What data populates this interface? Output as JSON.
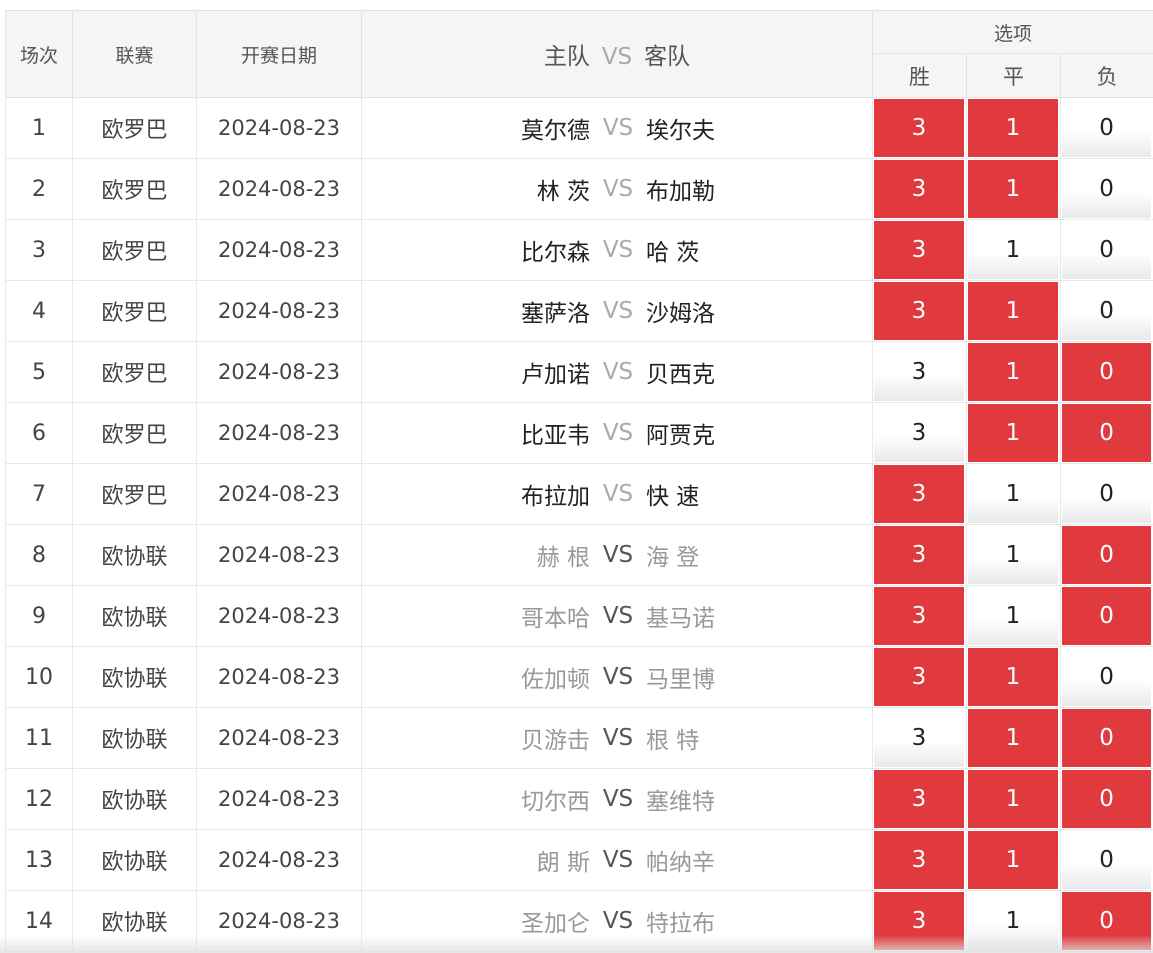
{
  "header": {
    "idx": "场次",
    "league": "联赛",
    "date": "开赛日期",
    "home": "主队",
    "vs": "VS",
    "away": "客队",
    "options": "选项",
    "win": "胜",
    "draw": "平",
    "lose": "负"
  },
  "colors": {
    "selected": "#e03a3e",
    "header_bg": "#f5f5f5"
  },
  "rows": [
    {
      "idx": "1",
      "league": "欧罗巴",
      "date": "2024-08-23",
      "home": "莫尔德",
      "vs": "VS",
      "away": "埃尔夫",
      "dim": false,
      "win": "3",
      "draw": "1",
      "lose": "0",
      "win_sel": true,
      "draw_sel": true,
      "lose_sel": false
    },
    {
      "idx": "2",
      "league": "欧罗巴",
      "date": "2024-08-23",
      "home": "林 茨",
      "vs": "VS",
      "away": "布加勒",
      "dim": false,
      "win": "3",
      "draw": "1",
      "lose": "0",
      "win_sel": true,
      "draw_sel": true,
      "lose_sel": false
    },
    {
      "idx": "3",
      "league": "欧罗巴",
      "date": "2024-08-23",
      "home": "比尔森",
      "vs": "VS",
      "away": "哈 茨",
      "dim": false,
      "win": "3",
      "draw": "1",
      "lose": "0",
      "win_sel": true,
      "draw_sel": false,
      "lose_sel": false
    },
    {
      "idx": "4",
      "league": "欧罗巴",
      "date": "2024-08-23",
      "home": "塞萨洛",
      "vs": "VS",
      "away": "沙姆洛",
      "dim": false,
      "win": "3",
      "draw": "1",
      "lose": "0",
      "win_sel": true,
      "draw_sel": true,
      "lose_sel": false
    },
    {
      "idx": "5",
      "league": "欧罗巴",
      "date": "2024-08-23",
      "home": "卢加诺",
      "vs": "VS",
      "away": "贝西克",
      "dim": false,
      "win": "3",
      "draw": "1",
      "lose": "0",
      "win_sel": false,
      "draw_sel": true,
      "lose_sel": true
    },
    {
      "idx": "6",
      "league": "欧罗巴",
      "date": "2024-08-23",
      "home": "比亚韦",
      "vs": "VS",
      "away": "阿贾克",
      "dim": false,
      "win": "3",
      "draw": "1",
      "lose": "0",
      "win_sel": false,
      "draw_sel": true,
      "lose_sel": true
    },
    {
      "idx": "7",
      "league": "欧罗巴",
      "date": "2024-08-23",
      "home": "布拉加",
      "vs": "VS",
      "away": "快 速",
      "dim": false,
      "win": "3",
      "draw": "1",
      "lose": "0",
      "win_sel": true,
      "draw_sel": false,
      "lose_sel": false
    },
    {
      "idx": "8",
      "league": "欧协联",
      "date": "2024-08-23",
      "home": "赫 根",
      "vs": "VS",
      "away": "海 登",
      "dim": true,
      "win": "3",
      "draw": "1",
      "lose": "0",
      "win_sel": true,
      "draw_sel": false,
      "lose_sel": true
    },
    {
      "idx": "9",
      "league": "欧协联",
      "date": "2024-08-23",
      "home": "哥本哈",
      "vs": "VS",
      "away": "基马诺",
      "dim": true,
      "win": "3",
      "draw": "1",
      "lose": "0",
      "win_sel": true,
      "draw_sel": false,
      "lose_sel": true
    },
    {
      "idx": "10",
      "league": "欧协联",
      "date": "2024-08-23",
      "home": "佐加顿",
      "vs": "VS",
      "away": "马里博",
      "dim": true,
      "win": "3",
      "draw": "1",
      "lose": "0",
      "win_sel": true,
      "draw_sel": true,
      "lose_sel": false
    },
    {
      "idx": "11",
      "league": "欧协联",
      "date": "2024-08-23",
      "home": "贝游击",
      "vs": "VS",
      "away": "根 特",
      "dim": true,
      "win": "3",
      "draw": "1",
      "lose": "0",
      "win_sel": false,
      "draw_sel": true,
      "lose_sel": true
    },
    {
      "idx": "12",
      "league": "欧协联",
      "date": "2024-08-23",
      "home": "切尔西",
      "vs": "VS",
      "away": "塞维特",
      "dim": true,
      "win": "3",
      "draw": "1",
      "lose": "0",
      "win_sel": true,
      "draw_sel": true,
      "lose_sel": true
    },
    {
      "idx": "13",
      "league": "欧协联",
      "date": "2024-08-23",
      "home": "朗 斯",
      "vs": "VS",
      "away": "帕纳辛",
      "dim": true,
      "win": "3",
      "draw": "1",
      "lose": "0",
      "win_sel": true,
      "draw_sel": true,
      "lose_sel": false
    },
    {
      "idx": "14",
      "league": "欧协联",
      "date": "2024-08-23",
      "home": "圣加仑",
      "vs": "VS",
      "away": "特拉布",
      "dim": true,
      "win": "3",
      "draw": "1",
      "lose": "0",
      "win_sel": true,
      "draw_sel": false,
      "lose_sel": true
    }
  ]
}
